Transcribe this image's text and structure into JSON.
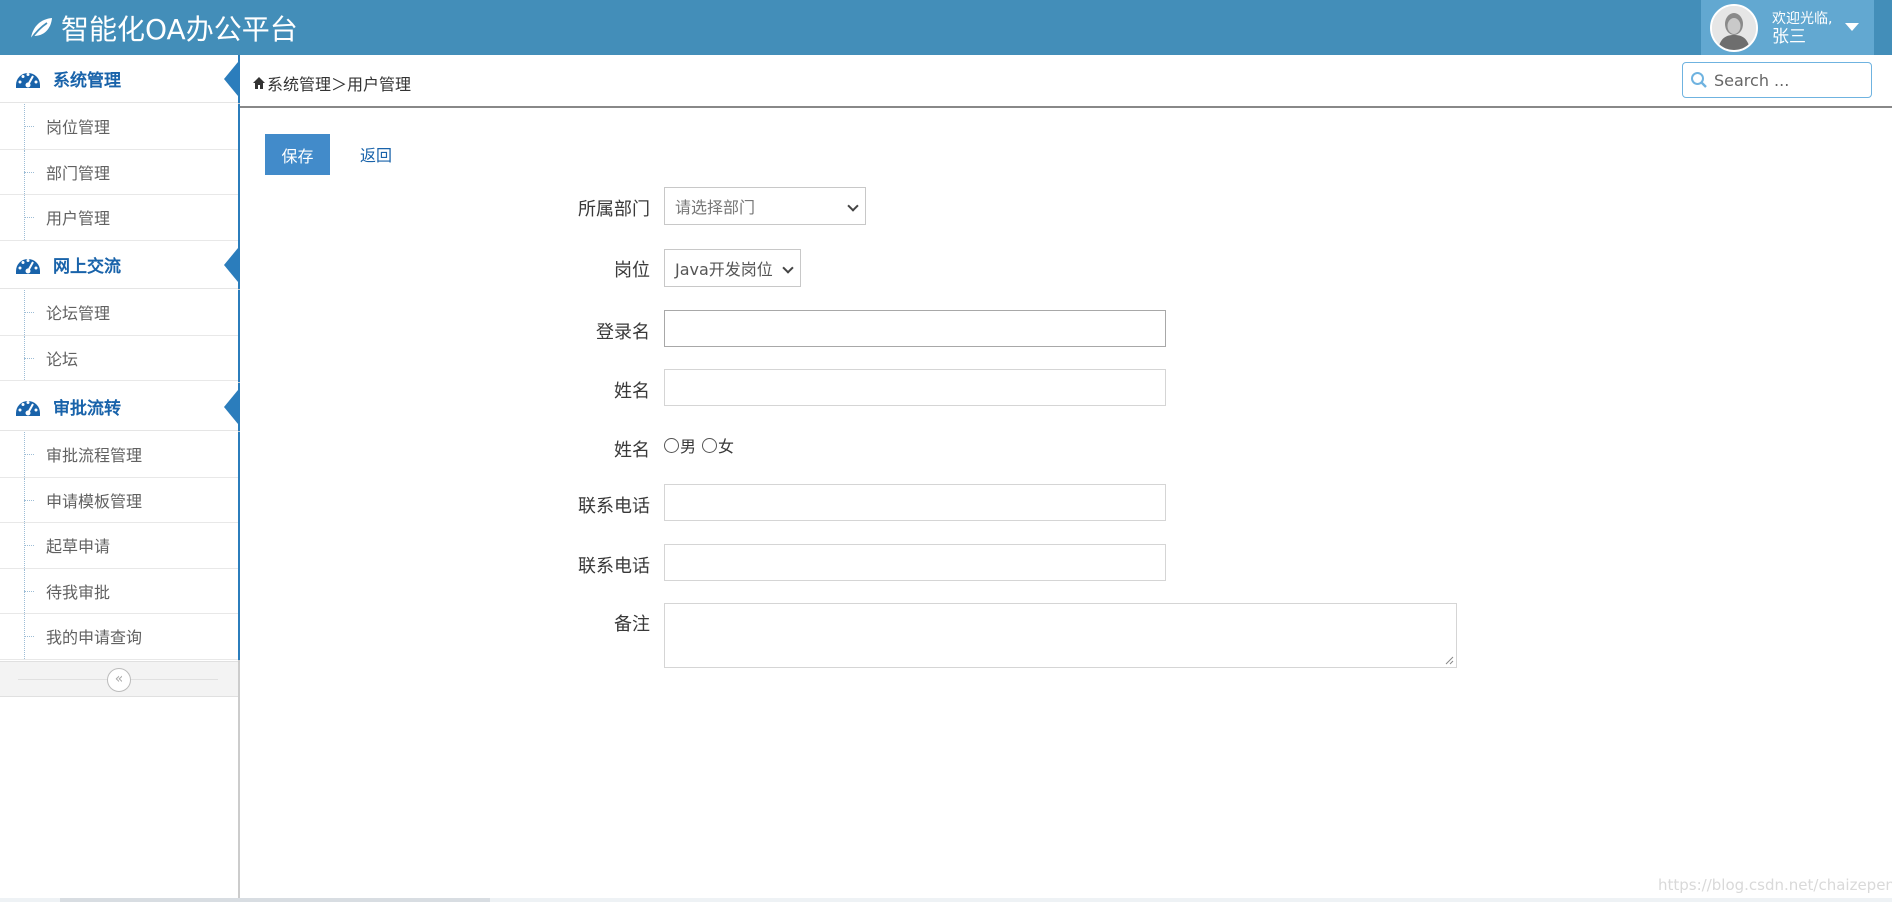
{
  "header": {
    "app_title": "智能化OA办公平台",
    "welcome": "欢迎光临,",
    "user_name": "张三"
  },
  "sidebar": {
    "groups": [
      {
        "label": "系统管理",
        "items": [
          {
            "label": "岗位管理"
          },
          {
            "label": "部门管理"
          },
          {
            "label": "用户管理"
          }
        ]
      },
      {
        "label": "网上交流",
        "items": [
          {
            "label": "论坛管理"
          },
          {
            "label": "论坛"
          }
        ]
      },
      {
        "label": "审批流转",
        "items": [
          {
            "label": "审批流程管理"
          },
          {
            "label": "申请模板管理"
          },
          {
            "label": "起草申请"
          },
          {
            "label": "待我审批"
          },
          {
            "label": "我的申请查询"
          }
        ]
      }
    ],
    "collapse_glyph": "«"
  },
  "breadcrumb": {
    "text": "系统管理＞用户管理"
  },
  "search": {
    "placeholder": "Search ..."
  },
  "toolbar": {
    "save_label": "保存",
    "back_label": "返回"
  },
  "form": {
    "department": {
      "label": "所属部门",
      "value": "请选择部门"
    },
    "position": {
      "label": "岗位",
      "value": "Java开发岗位"
    },
    "login_name": {
      "label": "登录名",
      "value": ""
    },
    "name": {
      "label": "姓名",
      "value": ""
    },
    "gender": {
      "label": "姓名",
      "options": [
        "男",
        "女"
      ],
      "selected": null
    },
    "phone1": {
      "label": "联系电话",
      "value": ""
    },
    "phone2": {
      "label": "联系电话",
      "value": ""
    },
    "remark": {
      "label": "备注",
      "value": ""
    }
  },
  "watermark": "https://blog.csdn.net/chaizepeng",
  "colors": {
    "navbar": "#438eb9",
    "user_box": "#62a8d1",
    "menu_accent": "#2b7dbc",
    "menu_text": "#1963aa",
    "save_button": "#428bca"
  }
}
